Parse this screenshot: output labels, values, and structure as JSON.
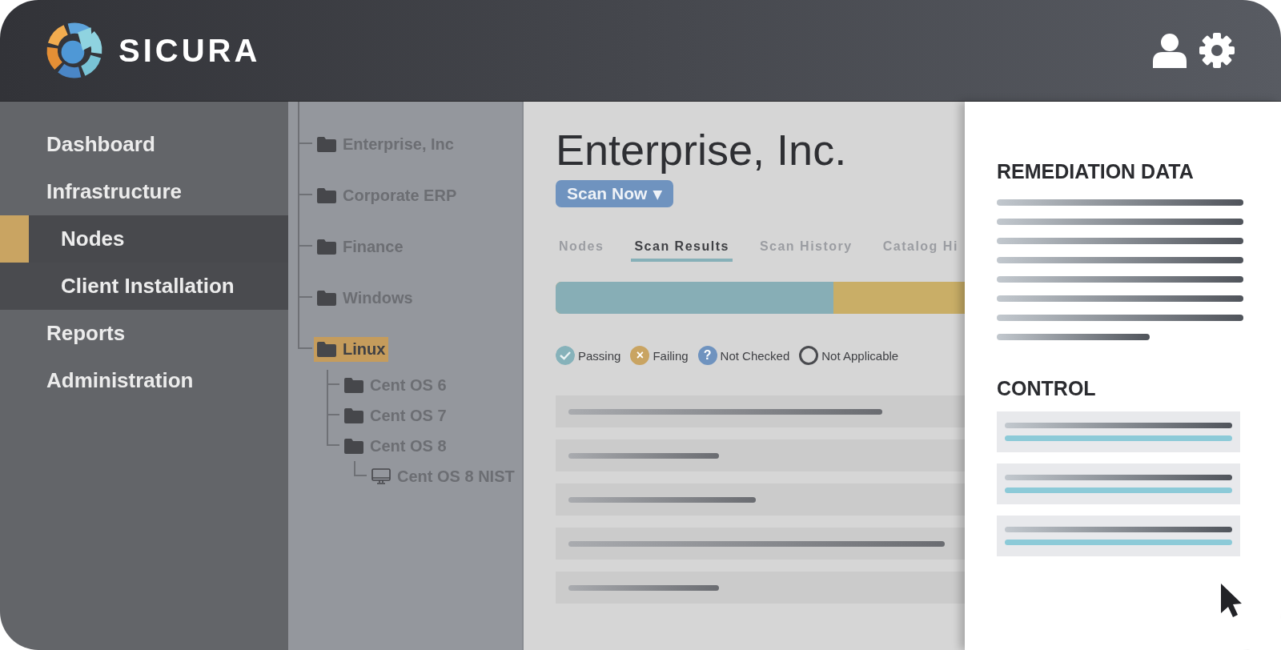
{
  "header": {
    "brand": "SICURA"
  },
  "sidebar": {
    "items": [
      {
        "label": "Dashboard",
        "selected": false
      },
      {
        "label": "Infrastructure",
        "selected": false,
        "expanded": true,
        "children": [
          {
            "label": "Nodes",
            "selected": true
          },
          {
            "label": "Client Installation",
            "selected": false
          }
        ]
      },
      {
        "label": "Reports",
        "selected": false
      },
      {
        "label": "Administration",
        "selected": false
      }
    ]
  },
  "tree": {
    "items": [
      {
        "label": "Enterprise, Inc",
        "kind": "folder",
        "selected": false
      },
      {
        "label": "Corporate ERP",
        "kind": "folder",
        "selected": false
      },
      {
        "label": "Finance",
        "kind": "folder",
        "selected": false
      },
      {
        "label": "Windows",
        "kind": "folder",
        "selected": false
      },
      {
        "label": "Linux",
        "kind": "folder",
        "selected": true,
        "children": [
          {
            "label": "Cent OS 6",
            "kind": "folder",
            "selected": false
          },
          {
            "label": "Cent OS 7",
            "kind": "folder",
            "selected": false
          },
          {
            "label": "Cent OS 8",
            "kind": "folder",
            "selected": false,
            "children": [
              {
                "label": "Cent OS 8 NIST",
                "kind": "computer",
                "selected": false
              }
            ]
          }
        ]
      }
    ]
  },
  "main": {
    "title": "Enterprise, Inc.",
    "scan_button": {
      "label": "Scan Now",
      "caret": "▾"
    },
    "tabs": [
      {
        "label": "Nodes",
        "selected": false
      },
      {
        "label": "Scan Results",
        "selected": true
      },
      {
        "label": "Scan History",
        "selected": false
      },
      {
        "label": "Catalog Hi",
        "selected": false
      }
    ],
    "results_bar": {
      "level": 0.68
    },
    "legend": [
      {
        "label": "Passing",
        "kind": "passing"
      },
      {
        "label": "Failing",
        "kind": "failing",
        "symbol": "×"
      },
      {
        "label": "Not Checked",
        "kind": "not_checked",
        "symbol": "?"
      },
      {
        "label": "Not Applicable",
        "kind": "not_applicable"
      }
    ]
  },
  "detail_panel": {
    "sections": [
      {
        "title": "REMEDIATION DATA",
        "kind": "lines"
      },
      {
        "title": "CONTROL",
        "kind": "cards"
      }
    ]
  }
}
